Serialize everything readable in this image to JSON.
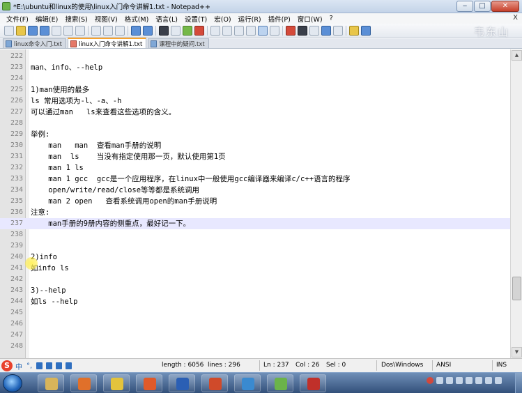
{
  "window": {
    "title": "*E:\\ubuntu和linux的使用\\linux入门命令讲解1.txt - Notepad++",
    "minimize_glyph": "‒",
    "maximize_glyph": "□",
    "close_glyph": "✕"
  },
  "menu": {
    "items": [
      "文件(F)",
      "编辑(E)",
      "搜索(S)",
      "视图(V)",
      "格式(M)",
      "语言(L)",
      "设置(T)",
      "宏(O)",
      "运行(R)",
      "插件(P)",
      "窗口(W)",
      "?"
    ],
    "close_glyph": "X"
  },
  "watermark": "韦东山",
  "tabs": [
    {
      "label": "linux命令入门.txt",
      "active": false,
      "icon": "saved-file-icon"
    },
    {
      "label": "linux入门命令讲解1.txt",
      "active": true,
      "icon": "unsaved-file-icon"
    },
    {
      "label": "课程中的疑问.txt",
      "active": false,
      "icon": "saved-file-icon"
    }
  ],
  "editor": {
    "current_line": "237",
    "lines": [
      {
        "n": "222",
        "t": ""
      },
      {
        "n": "223",
        "t": "man、info、--help"
      },
      {
        "n": "224",
        "t": ""
      },
      {
        "n": "225",
        "t": "1)man使用的最多"
      },
      {
        "n": "226",
        "t": "ls 常用选项为-l、-a、-h"
      },
      {
        "n": "227",
        "t": "可以通过man   ls来查看这些选项的含义。"
      },
      {
        "n": "228",
        "t": ""
      },
      {
        "n": "229",
        "t": "举例:"
      },
      {
        "n": "230",
        "t": "    man   man  查看man手册的说明"
      },
      {
        "n": "231",
        "t": "    man  ls    当没有指定使用那一页，默认使用第1页"
      },
      {
        "n": "232",
        "t": "    man 1 ls"
      },
      {
        "n": "233",
        "t": "    man 1 gcc  gcc是一个应用程序，在linux中一般使用gcc编译器来编译c/c++语言的程序"
      },
      {
        "n": "234",
        "t": "    open/write/read/close等等都是系统调用"
      },
      {
        "n": "235",
        "t": "    man 2 open   查看系统调用open的man手册说明"
      },
      {
        "n": "236",
        "t": "注意:"
      },
      {
        "n": "237",
        "t": "    man手册的9册内容的侧重点，最好记一下。"
      },
      {
        "n": "238",
        "t": ""
      },
      {
        "n": "239",
        "t": ""
      },
      {
        "n": "240",
        "t": "2)info"
      },
      {
        "n": "241",
        "t": "如info ls"
      },
      {
        "n": "242",
        "t": ""
      },
      {
        "n": "243",
        "t": "3)--help"
      },
      {
        "n": "244",
        "t": "如ls --help"
      },
      {
        "n": "245",
        "t": ""
      },
      {
        "n": "246",
        "t": ""
      },
      {
        "n": "247",
        "t": ""
      },
      {
        "n": "248",
        "t": ""
      }
    ]
  },
  "scrollbar": {
    "up_glyph": "▲",
    "down_glyph": "▼"
  },
  "statusbar": {
    "ime_logo": "S",
    "ime_lang": "中",
    "ime_punct": "°,",
    "length": "length : 6056",
    "lines": "lines : 296",
    "ln": "Ln : 237",
    "col": "Col : 26",
    "sel": "Sel : 0",
    "eol": "Dos\\Windows",
    "encoding": "ANSI",
    "mode": "INS"
  },
  "taskbar": {
    "apps": [
      {
        "name": "file-explorer-icon",
        "color": "#d8b45a"
      },
      {
        "name": "firefox-icon",
        "color": "#e0702a"
      },
      {
        "name": "paint-icon",
        "color": "#e3c33c"
      },
      {
        "name": "pdf-reader-icon",
        "color": "#e05a2a"
      },
      {
        "name": "word-icon",
        "color": "#2b5fb4"
      },
      {
        "name": "powerpoint-icon",
        "color": "#d04a2a"
      },
      {
        "name": "filter-tool-icon",
        "color": "#3a8ad0"
      },
      {
        "name": "notepadpp-icon",
        "color": "#6bb34a"
      },
      {
        "name": "recorder-icon",
        "color": "#c0302a"
      }
    ]
  }
}
